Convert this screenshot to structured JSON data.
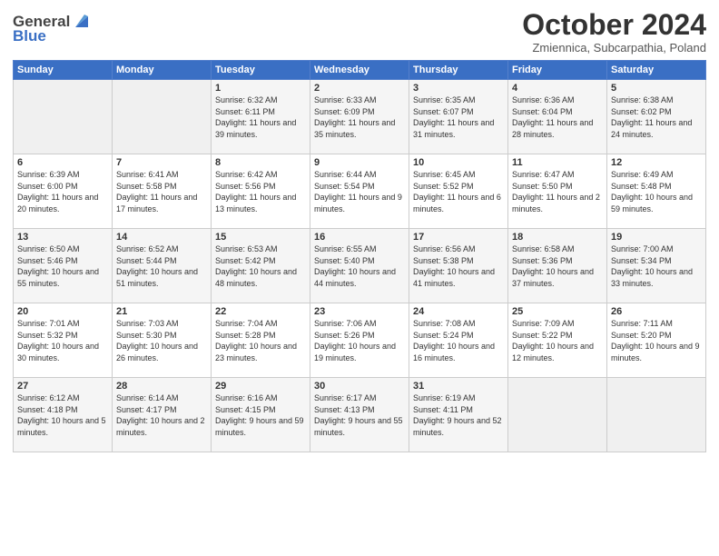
{
  "header": {
    "logo_line1": "General",
    "logo_line2": "Blue",
    "month": "October 2024",
    "location": "Zmiennica, Subcarpathia, Poland"
  },
  "days_of_week": [
    "Sunday",
    "Monday",
    "Tuesday",
    "Wednesday",
    "Thursday",
    "Friday",
    "Saturday"
  ],
  "weeks": [
    [
      {
        "day": "",
        "info": ""
      },
      {
        "day": "",
        "info": ""
      },
      {
        "day": "1",
        "info": "Sunrise: 6:32 AM\nSunset: 6:11 PM\nDaylight: 11 hours and 39 minutes."
      },
      {
        "day": "2",
        "info": "Sunrise: 6:33 AM\nSunset: 6:09 PM\nDaylight: 11 hours and 35 minutes."
      },
      {
        "day": "3",
        "info": "Sunrise: 6:35 AM\nSunset: 6:07 PM\nDaylight: 11 hours and 31 minutes."
      },
      {
        "day": "4",
        "info": "Sunrise: 6:36 AM\nSunset: 6:04 PM\nDaylight: 11 hours and 28 minutes."
      },
      {
        "day": "5",
        "info": "Sunrise: 6:38 AM\nSunset: 6:02 PM\nDaylight: 11 hours and 24 minutes."
      }
    ],
    [
      {
        "day": "6",
        "info": "Sunrise: 6:39 AM\nSunset: 6:00 PM\nDaylight: 11 hours and 20 minutes."
      },
      {
        "day": "7",
        "info": "Sunrise: 6:41 AM\nSunset: 5:58 PM\nDaylight: 11 hours and 17 minutes."
      },
      {
        "day": "8",
        "info": "Sunrise: 6:42 AM\nSunset: 5:56 PM\nDaylight: 11 hours and 13 minutes."
      },
      {
        "day": "9",
        "info": "Sunrise: 6:44 AM\nSunset: 5:54 PM\nDaylight: 11 hours and 9 minutes."
      },
      {
        "day": "10",
        "info": "Sunrise: 6:45 AM\nSunset: 5:52 PM\nDaylight: 11 hours and 6 minutes."
      },
      {
        "day": "11",
        "info": "Sunrise: 6:47 AM\nSunset: 5:50 PM\nDaylight: 11 hours and 2 minutes."
      },
      {
        "day": "12",
        "info": "Sunrise: 6:49 AM\nSunset: 5:48 PM\nDaylight: 10 hours and 59 minutes."
      }
    ],
    [
      {
        "day": "13",
        "info": "Sunrise: 6:50 AM\nSunset: 5:46 PM\nDaylight: 10 hours and 55 minutes."
      },
      {
        "day": "14",
        "info": "Sunrise: 6:52 AM\nSunset: 5:44 PM\nDaylight: 10 hours and 51 minutes."
      },
      {
        "day": "15",
        "info": "Sunrise: 6:53 AM\nSunset: 5:42 PM\nDaylight: 10 hours and 48 minutes."
      },
      {
        "day": "16",
        "info": "Sunrise: 6:55 AM\nSunset: 5:40 PM\nDaylight: 10 hours and 44 minutes."
      },
      {
        "day": "17",
        "info": "Sunrise: 6:56 AM\nSunset: 5:38 PM\nDaylight: 10 hours and 41 minutes."
      },
      {
        "day": "18",
        "info": "Sunrise: 6:58 AM\nSunset: 5:36 PM\nDaylight: 10 hours and 37 minutes."
      },
      {
        "day": "19",
        "info": "Sunrise: 7:00 AM\nSunset: 5:34 PM\nDaylight: 10 hours and 33 minutes."
      }
    ],
    [
      {
        "day": "20",
        "info": "Sunrise: 7:01 AM\nSunset: 5:32 PM\nDaylight: 10 hours and 30 minutes."
      },
      {
        "day": "21",
        "info": "Sunrise: 7:03 AM\nSunset: 5:30 PM\nDaylight: 10 hours and 26 minutes."
      },
      {
        "day": "22",
        "info": "Sunrise: 7:04 AM\nSunset: 5:28 PM\nDaylight: 10 hours and 23 minutes."
      },
      {
        "day": "23",
        "info": "Sunrise: 7:06 AM\nSunset: 5:26 PM\nDaylight: 10 hours and 19 minutes."
      },
      {
        "day": "24",
        "info": "Sunrise: 7:08 AM\nSunset: 5:24 PM\nDaylight: 10 hours and 16 minutes."
      },
      {
        "day": "25",
        "info": "Sunrise: 7:09 AM\nSunset: 5:22 PM\nDaylight: 10 hours and 12 minutes."
      },
      {
        "day": "26",
        "info": "Sunrise: 7:11 AM\nSunset: 5:20 PM\nDaylight: 10 hours and 9 minutes."
      }
    ],
    [
      {
        "day": "27",
        "info": "Sunrise: 6:12 AM\nSunset: 4:18 PM\nDaylight: 10 hours and 5 minutes."
      },
      {
        "day": "28",
        "info": "Sunrise: 6:14 AM\nSunset: 4:17 PM\nDaylight: 10 hours and 2 minutes."
      },
      {
        "day": "29",
        "info": "Sunrise: 6:16 AM\nSunset: 4:15 PM\nDaylight: 9 hours and 59 minutes."
      },
      {
        "day": "30",
        "info": "Sunrise: 6:17 AM\nSunset: 4:13 PM\nDaylight: 9 hours and 55 minutes."
      },
      {
        "day": "31",
        "info": "Sunrise: 6:19 AM\nSunset: 4:11 PM\nDaylight: 9 hours and 52 minutes."
      },
      {
        "day": "",
        "info": ""
      },
      {
        "day": "",
        "info": ""
      }
    ]
  ]
}
